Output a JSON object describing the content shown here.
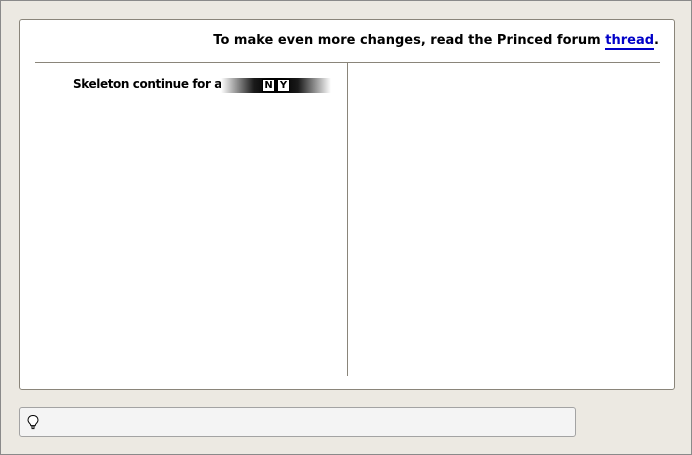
{
  "header": {
    "text": "To make even more changes, read the Princed forum ",
    "link_label": "thread",
    "suffix": "."
  },
  "option": {
    "label": "Skeleton continue for all:",
    "choices": {
      "no": "N",
      "yes": "Y"
    }
  },
  "statusbar": {
    "icon": "lightbulb-icon",
    "text": ""
  },
  "colors": {
    "background": "#ece9e2",
    "panel": "#ffffff",
    "link": "#0000c8",
    "statusbar": "#f4f4f4"
  }
}
